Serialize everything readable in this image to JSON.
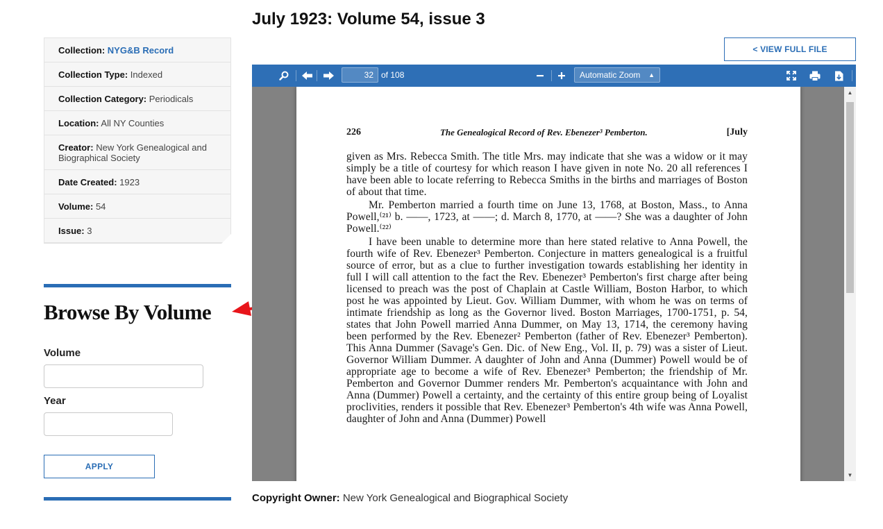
{
  "page": {
    "title": "July 1923: Volume 54, issue 3"
  },
  "metadata": [
    {
      "label": "Collection:",
      "value": "NYG&B Record",
      "is_link": true
    },
    {
      "label": "Collection Type:",
      "value": "Indexed"
    },
    {
      "label": "Collection Category:",
      "value": "Periodicals"
    },
    {
      "label": "Location:",
      "value": "All NY Counties"
    },
    {
      "label": "Creator:",
      "value": "New York Genealogical and Biographical Society"
    },
    {
      "label": "Date Created:",
      "value": "1923"
    },
    {
      "label": "Volume:",
      "value": "54"
    },
    {
      "label": "Issue:",
      "value": "3"
    }
  ],
  "browse": {
    "heading": "Browse By Volume",
    "volume_label": "Volume",
    "volume_value": "",
    "year_label": "Year",
    "year_value": "",
    "apply_label": "APPLY"
  },
  "view_full_file_label": "< VIEW FULL FILE",
  "viewer": {
    "current_page": "32",
    "page_count_text": "of 108",
    "zoom_label": "Automatic Zoom",
    "toolbar_icons": [
      "search-icon",
      "previous-page-icon",
      "next-page-icon",
      "zoom-out-icon",
      "zoom-in-icon",
      "presentation-mode-icon",
      "print-icon",
      "download-icon"
    ],
    "accent_color": "#2e6fb6"
  },
  "document": {
    "page_number": "226",
    "running_title": "The Genealogical Record of Rev. Ebenezer³ Pemberton.",
    "running_month": "[July",
    "paragraphs": [
      "given as Mrs. Rebecca Smith. The title Mrs. may indicate that she was a widow or it may simply be a title of courtesy for which reason I have given in note No. 20 all references I have been able to locate referring to Rebecca Smiths in the births and marriages of Boston of about that time.",
      "Mr. Pemberton married a fourth time on June 13, 1768, at Boston, Mass., to Anna Powell,⁽²¹⁾ b. ——, 1723, at ——; d. March 8, 1770, at ——? She was a daughter of John Powell.⁽²²⁾",
      "I have been unable to determine more than here stated relative to Anna Powell, the fourth wife of Rev. Ebenezer³ Pemberton. Conjecture in matters genealogical is a fruitful source of error, but as a clue to further investigation towards establishing her identity in full I will call attention to the fact the Rev. Ebenezer³ Pemberton's first charge after being licensed to preach was the post of Chaplain at Castle William, Boston Harbor, to which post he was appointed by Lieut. Gov. William Dummer, with whom he was on terms of intimate friendship as long as the Governor lived. Boston Marriages, 1700-1751, p. 54, states that John Powell married Anna Dummer, on May 13, 1714, the ceremony having been performed by the Rev. Ebenezer² Pemberton (father of Rev. Ebenezer³ Pemberton). This Anna Dummer (Savage's Gen. Dic. of New Eng., Vol. II, p. 79) was a sister of Lieut. Governor William Dummer. A daughter of John and Anna (Dummer) Powell would be of appropriate age to become a wife of Rev. Ebenezer³ Pemberton; the friendship of Mr. Pemberton and Governor Dummer renders Mr. Pemberton's acquaintance with John and Anna (Dummer) Powell a certainty, and the certainty of this entire group being of Loyalist proclivities, renders it possible that Rev. Ebenezer³ Pemberton's 4th wife was Anna Powell, daughter of John and Anna (Dummer) Powell"
    ]
  },
  "copyright": {
    "label": "Copyright Owner:",
    "value": "New York Genealogical and Biographical Society"
  },
  "colors": {
    "brand_blue": "#2a6db5",
    "annotation_arrow": "#e8151b"
  }
}
